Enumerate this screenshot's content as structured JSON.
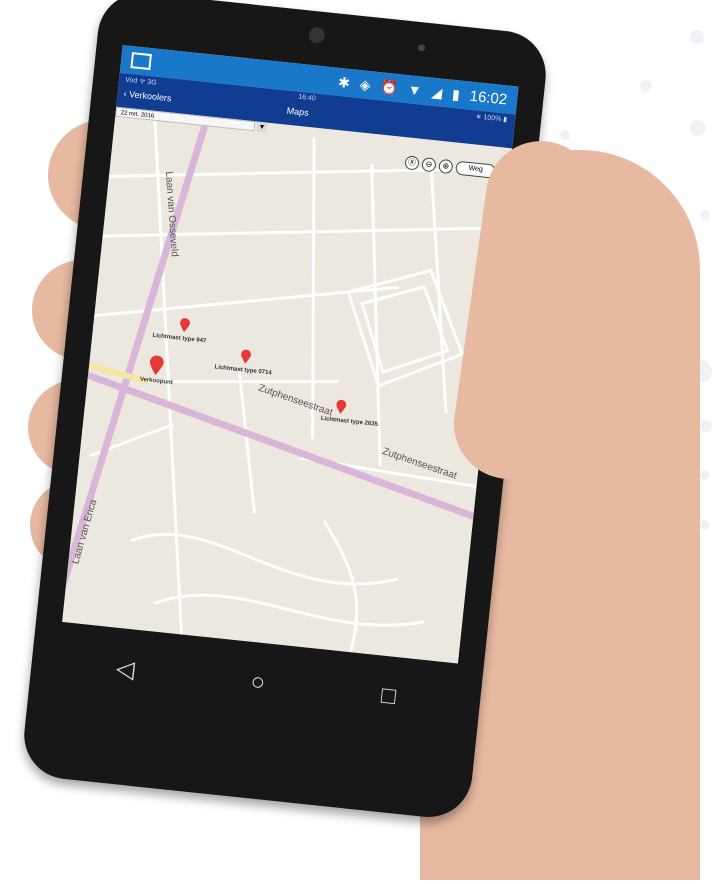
{
  "status_bar": {
    "time": "16:02",
    "icons": [
      "bluetooth-icon",
      "vibrate-icon",
      "alarm-icon",
      "wifi-icon",
      "signal-icon",
      "battery-icon"
    ]
  },
  "app_bar": {
    "inner_status": "Vod  ᯤ 3G",
    "inner_time": "16:40",
    "inner_battery": "∗ 100% ▮",
    "back_label": "Verkoolers",
    "title": "Maps"
  },
  "filter": {
    "value": "22 mrt. 2016"
  },
  "map_controls": {
    "buttons": [
      "Ⓧ",
      "⊖",
      "⊕"
    ],
    "map_type": "Weg"
  },
  "map": {
    "streets": [
      "Laan van Osseveld",
      "Zutphenseestraat",
      "Laan van Erica",
      "Zutphenseestraat"
    ],
    "pins": [
      {
        "label": "Lichtmast type 947"
      },
      {
        "label": "Lichtmast type 0714"
      },
      {
        "label": "Lichtmast type 2635"
      },
      {
        "label": "Verkoopunt"
      }
    ]
  },
  "navbar": {
    "back": "◁",
    "home": "○",
    "recent": "□"
  },
  "colors": {
    "statusbar": "#1978c9",
    "appbar": "#103c92",
    "map_bg": "#ece8e0",
    "road_major": "#d7b6d9",
    "road_minor": "#ffffff",
    "pin": "#e53935"
  }
}
